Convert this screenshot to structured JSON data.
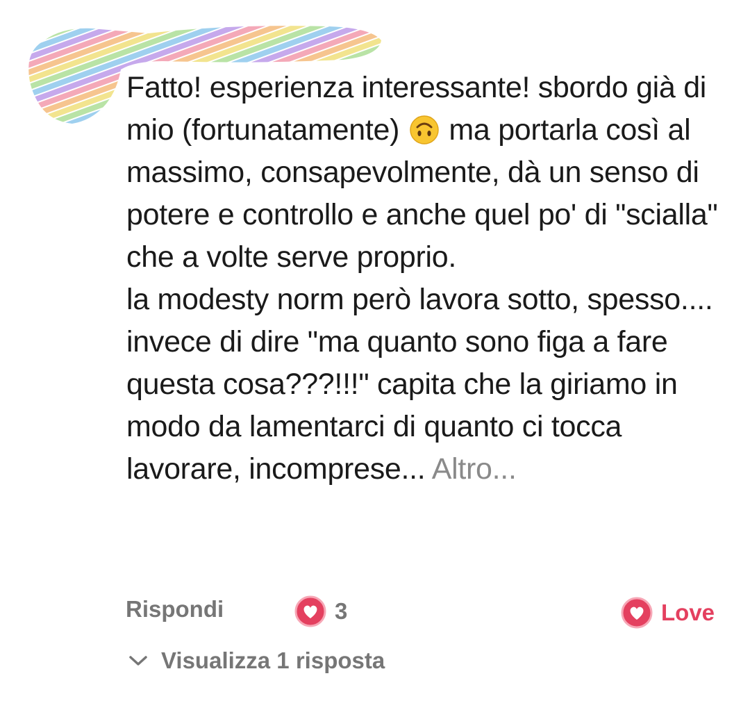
{
  "comment": {
    "paragraphs": [
      {
        "before_emoji": "Fatto! esperienza interessante! sbordo già di mio (fortunatamente) ",
        "after_emoji": " ma portarla così al massimo, consapevolmente, dà un senso di potere e controllo e anche quel po' di \"scialla\" che a volte serve proprio."
      },
      {
        "text": "la modesty norm però lavora sotto, spesso...."
      },
      {
        "text": "invece di dire \"ma quanto sono figa a fare questa cosa???!!!\" capita che la giriamo in modo da lamentarci di quanto ci tocca lavorare,  incomprese...",
        "more_label": "Altro..."
      }
    ],
    "emoji": "upside-down-face-icon"
  },
  "actions": {
    "reply_label": "Rispondi",
    "like_count": "3",
    "love_label": "Love"
  },
  "replies": {
    "toggle_label": "Visualizza 1 risposta"
  },
  "colors": {
    "text": "#1a1a1a",
    "muted": "#767676",
    "love": "#e4405f"
  }
}
